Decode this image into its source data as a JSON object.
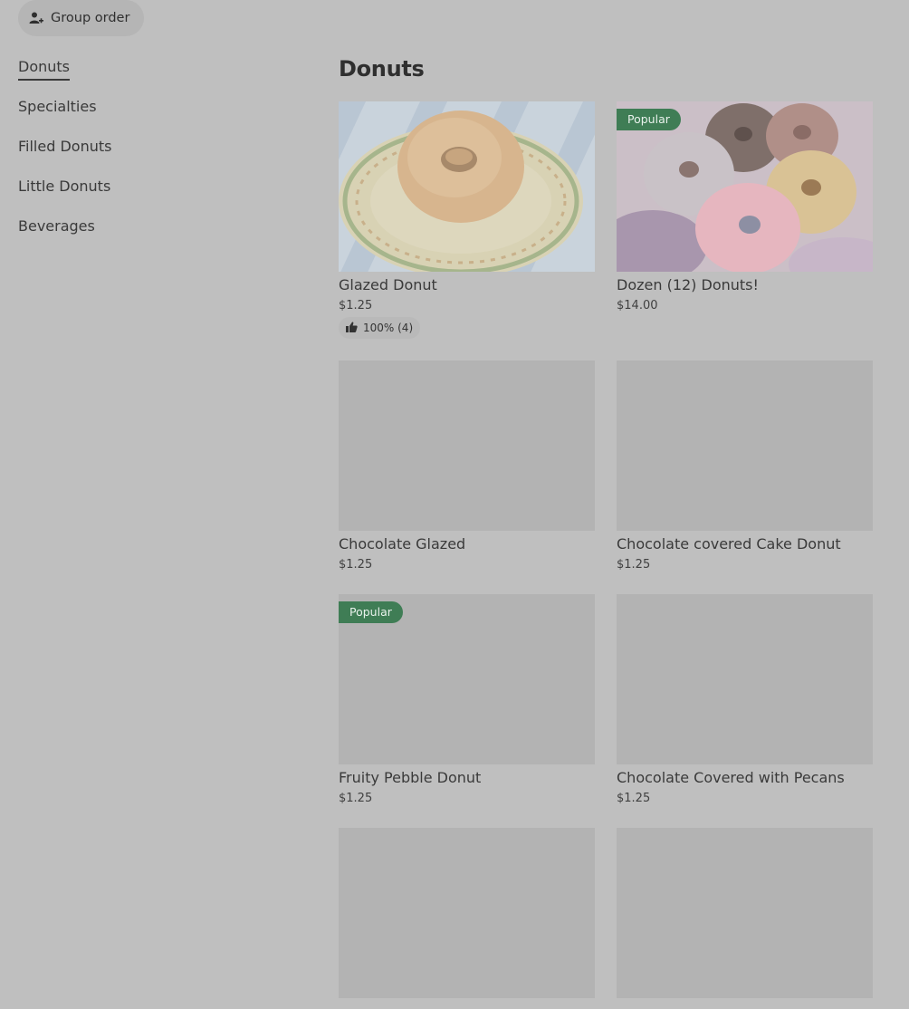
{
  "header": {
    "group_order_label": "Group order"
  },
  "sidebar": {
    "items": [
      {
        "label": "Donuts"
      },
      {
        "label": "Specialties"
      },
      {
        "label": "Filled Donuts"
      },
      {
        "label": "Little Donuts"
      },
      {
        "label": "Beverages"
      }
    ]
  },
  "section": {
    "title": "Donuts"
  },
  "items": [
    {
      "name": "Glazed Donut",
      "price": "$1.25",
      "rating": "100% (4)"
    },
    {
      "name": "Dozen (12) Donuts!",
      "price": "$14.00",
      "badge": "Popular"
    },
    {
      "name": "Chocolate Glazed",
      "price": "$1.25"
    },
    {
      "name": "Chocolate covered Cake Donut",
      "price": "$1.25"
    },
    {
      "name": "Fruity Pebble Donut",
      "price": "$1.25",
      "badge": "Popular"
    },
    {
      "name": "Chocolate Covered with Pecans",
      "price": "$1.25"
    }
  ],
  "colors": {
    "badge_green": "#3f7d55",
    "overlay_gray": "#bfbfbf"
  }
}
